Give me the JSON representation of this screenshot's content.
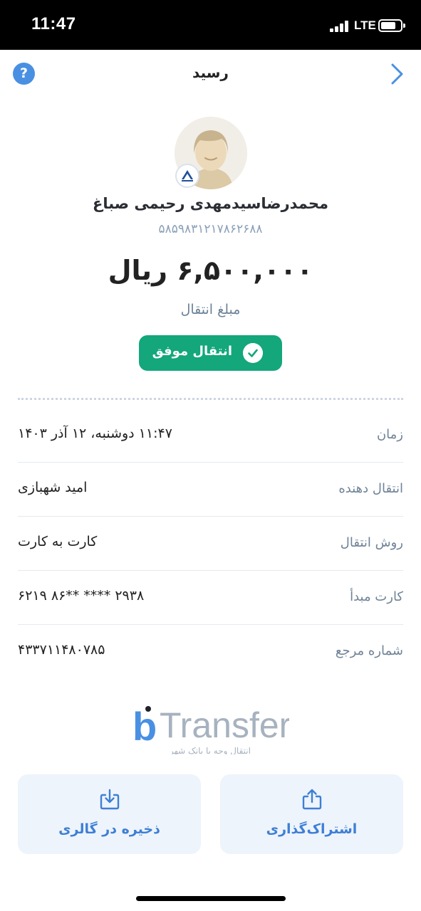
{
  "status_bar": {
    "time": "11:47",
    "network": "LTE"
  },
  "header": {
    "title": "رسید",
    "help_icon": "question-circle-icon",
    "back_icon": "chevron-right-icon"
  },
  "recipient": {
    "name": "محمدرضاسیدمهدی رحیمی صباغ",
    "card_number": "۵۸۵۹۸۳۱۲۱۷۸۶۲۶۸۸",
    "avatar_icon": "user-avatar",
    "bank_icon": "bank-logo-icon"
  },
  "transfer": {
    "amount": "۶,۵۰۰,۰۰۰ ریال",
    "amount_label": "مبلغ انتقال",
    "status": "انتقال موفق",
    "status_icon": "check-circle-icon"
  },
  "details": [
    {
      "label": "زمان",
      "value": "۱۱:۴۷ دوشنبه، ۱۲ آذر ۱۴۰۳"
    },
    {
      "label": "انتقال دهنده",
      "value": "امید شهبازی"
    },
    {
      "label": "روش انتقال",
      "value": "کارت به کارت"
    },
    {
      "label": "کارت مبدأ",
      "value": "۶۲۱۹ ۸۶** **** ۲۹۳۸"
    },
    {
      "label": "شماره مرجع",
      "value": "۴۳۳۷۱۱۴۸۰۷۸۵"
    }
  ],
  "brand": {
    "b": "b",
    "name": "Transfer",
    "tagline": "انتقال وجه با بانک شهر"
  },
  "actions": {
    "save": {
      "label": "ذخیره در گالری",
      "icon": "download-icon"
    },
    "share": {
      "label": "اشتراک‌گذاری",
      "icon": "share-icon"
    }
  },
  "colors": {
    "accent": "#4a90e2",
    "success": "#13a77b",
    "action_bg": "#eef4fb",
    "action_text": "#3d7fd6",
    "muted_text": "#6f8397"
  }
}
